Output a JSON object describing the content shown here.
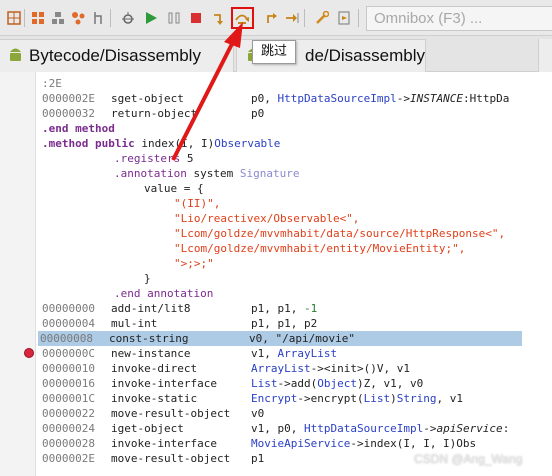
{
  "toolbar": {
    "icons": [
      "grid-icon",
      "tiles-icon",
      "nodes-icon",
      "fork-icon",
      "bug-icon",
      "play-icon",
      "pause-icon",
      "stop-icon",
      "step-into-icon",
      "step-over-icon",
      "step-return-icon",
      "run-to-line-icon",
      "wrench-icon",
      "export-icon"
    ],
    "omnibox_placeholder": "Omnibox (F3) ..."
  },
  "tooltip": {
    "text": "跳过"
  },
  "tabs": [
    {
      "label": "Bytecode/Disassembly"
    },
    {
      "label_left": "B",
      "label_right": "de/Disassembly"
    }
  ],
  "code_lines": [
    {
      "addr": ":2E",
      "kind": "label"
    },
    {
      "addr": "0000002E",
      "op": "sget-object",
      "args_plain": "p0, ",
      "cls": "HttpDataSourceImpl",
      "rest": "->",
      "it": "INSTANCE",
      "tail": ":HttpDa"
    },
    {
      "addr": "00000032",
      "op": "return-object",
      "args_plain": "p0"
    },
    {
      "kw": ".end method"
    },
    {
      "kw": ".method public",
      "plain": " index(I, I)",
      "cls": "Observable"
    },
    {
      "dir": ".registers",
      "plain": " 5"
    },
    {
      "dir": ".annotation",
      "plain": " system ",
      "ann": "Signature"
    },
    {
      "plain": "value = {"
    },
    {
      "str": "\"(II)\","
    },
    {
      "str": "\"Lio/reactivex/Observable<\","
    },
    {
      "str": "\"Lcom/goldze/mvvmhabit/data/source/HttpResponse<\","
    },
    {
      "str": "\"Lcom/goldze/mvvmhabit/entity/MovieEntity;\","
    },
    {
      "str": "\">;>;\""
    },
    {
      "plain": "}"
    },
    {
      "dir": ".end annotation"
    },
    {
      "addr": "00000000",
      "op": "add-int/lit8",
      "args_plain": "p1, p1, ",
      "num": "-1"
    },
    {
      "addr": "00000004",
      "op": "mul-int",
      "args_plain": "p1, p1, p2"
    },
    {
      "addr": "00000008",
      "op": "const-string",
      "args_plain": "v0, \"/api/movie\"",
      "highlight": true
    },
    {
      "addr": "0000000C",
      "op": "new-instance",
      "args_plain": "v1, ",
      "cls": "ArrayList"
    },
    {
      "addr": "00000010",
      "op": "invoke-direct",
      "cls": "ArrayList",
      "rest": "-><init>()V, v1"
    },
    {
      "addr": "00000016",
      "op": "invoke-interface",
      "cls": "List",
      "rest": "->add(",
      "cls2": "Object",
      "rest2": ")Z, v1, v0"
    },
    {
      "addr": "0000001C",
      "op": "invoke-static",
      "cls": "Encrypt",
      "rest": "->encrypt(",
      "cls2": "List",
      "rest2": ")",
      "cls3": "String",
      "rest3": ", v1"
    },
    {
      "addr": "00000022",
      "op": "move-result-object",
      "args_plain": "v0"
    },
    {
      "addr": "00000024",
      "op": "iget-object",
      "args_plain": "v1, p0, ",
      "cls": "HttpDataSourceImpl",
      "rest": "->",
      "it": "apiService",
      "tail": ":"
    },
    {
      "addr": "00000028",
      "op": "invoke-interface",
      "cls": "MovieApiService",
      "rest": "->index(I, I, I)Obs"
    },
    {
      "addr": "0000002E",
      "op": "move-result-object",
      "args_plain": "p1"
    }
  ],
  "watermark": "CSDN @Ang_Wang"
}
